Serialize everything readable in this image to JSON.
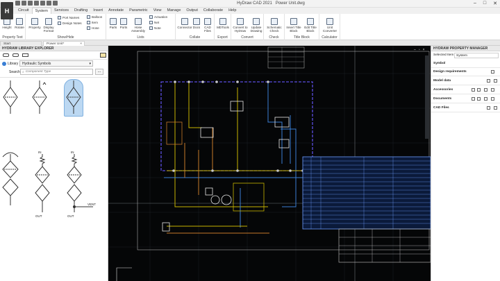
{
  "app": {
    "title": "HyDraw CAD 2021",
    "file": "Power Unit.dwg",
    "logo": "H"
  },
  "window_controls": {
    "minimize": "–",
    "maximize": "□",
    "close": "✕"
  },
  "ribbon_tabs": [
    "Circuit",
    "System",
    "Services",
    "Drafting",
    "Insert",
    "Annotate",
    "Parametric",
    "View",
    "Manage",
    "Output",
    "Collaborate",
    "Help"
  ],
  "active_tab": "System",
  "ribbon": {
    "property_text": {
      "label": "Property Text",
      "height": "Height",
      "rotate": "Rotate"
    },
    "show_hide": {
      "label": "Show/Hide",
      "property": "Property",
      "display_format": "Display Format",
      "port_names": "Port Names",
      "design_notes": "Design Notes",
      "balloon": "Balloon",
      "item": "Item",
      "hose": "Hose"
    },
    "lists": {
      "label": "Lists",
      "parts": "Parts",
      "ports": "Ports",
      "hose_assembly": "Hose Assembly",
      "actuation": "Actuation",
      "net": "Net",
      "note": "Note"
    },
    "collate": {
      "label": "Collate",
      "connector": "Connector",
      "docs": "Docs",
      "cad_files": "CAD Files"
    },
    "export": {
      "label": "Export",
      "mdtools": "MDTools"
    },
    "convert": {
      "label": "Convert",
      "convert_to_hydraw": "Convert to HyDraw",
      "update_drawing": "Update Drawing"
    },
    "check": {
      "label": "Check",
      "schematic_check": "Schematic Check"
    },
    "title_block": {
      "label": "Title Block",
      "insert_title_block": "Insert Title Block",
      "edit_title_block": "Edit Title Block"
    },
    "calculator": {
      "label": "Calculator",
      "unit_converter": "Unit Converter"
    }
  },
  "doc_tabs": [
    {
      "label": "Start"
    },
    {
      "label": "Power Unit*",
      "close": "×"
    }
  ],
  "library_explorer": {
    "title": "HYDRAW LIBRARY EXPLORER",
    "library_label": "Library",
    "library_value": "Hydraulic Symbols",
    "search_label": "Search",
    "search_placeholder": "Component Type",
    "more": "...",
    "port_labels": {
      "in1": "IN",
      "in2": "IN",
      "out1": "OUT",
      "out2": "OUT",
      "vent": "VENT"
    }
  },
  "property_manager": {
    "title": "HYDRAW PROPERTY MANAGER",
    "selected_item_label": "Selected Item",
    "selected_item_value": "System",
    "sections": [
      "Symbol",
      "Design requirements",
      "Model data",
      "Accessories",
      "Documents",
      "CAD Files"
    ]
  },
  "colors": {
    "canvas_bg": "#050607",
    "selection": "#5b4de0",
    "bom_table": "#6e9cff",
    "pipe_yellow": "#c8b400",
    "pipe_blue": "#3a7fd5",
    "pipe_orange": "#c87a2a",
    "ribbon_icon": "#5a6b80"
  }
}
